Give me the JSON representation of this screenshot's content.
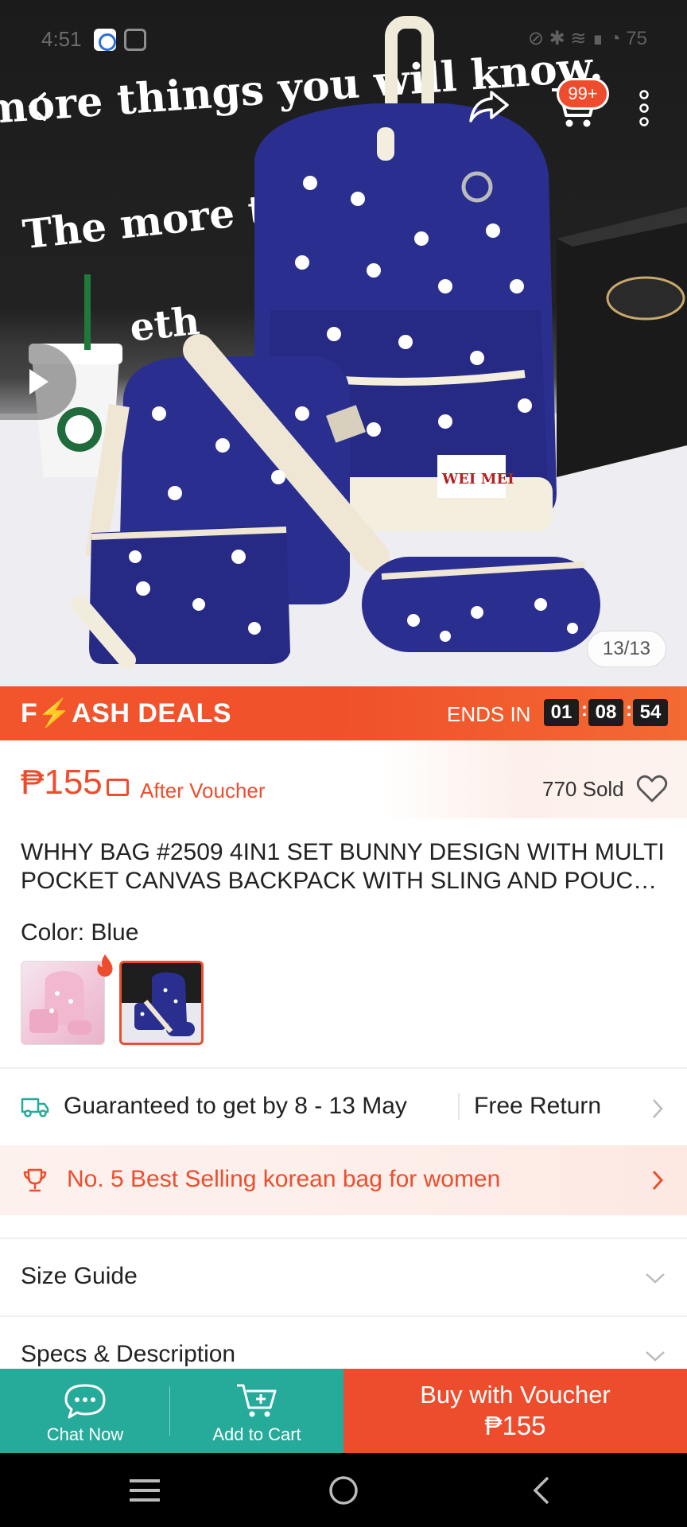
{
  "status_bar": {
    "time": "4:51",
    "right_text": "⊘ ✱ ≋ ∎ ◔ 75"
  },
  "hero": {
    "image_counter": "13/13",
    "cart_badge": "99+",
    "image_text": [
      "more things you will know.",
      "The more that",
      "eth"
    ],
    "tag_text": "WEI MEI"
  },
  "flash_deals": {
    "title": "F⚡ASH DEALS",
    "ends_label": "ENDS IN",
    "hours": "01",
    "minutes": "08",
    "seconds": "54"
  },
  "price": {
    "amount": "₱155",
    "after_voucher": "After Voucher",
    "sold": "770 Sold"
  },
  "product": {
    "title": "WHHY BAG #2509 4IN1 SET BUNNY DESIGN WITH MULTI POCKET CANVAS BACKPACK WITH SLING AND POUCH FOR WOMEN"
  },
  "color": {
    "label": "Color: Blue",
    "selected": "Blue"
  },
  "shipping": {
    "guarantee": "Guaranteed to get by 8 - 13 May",
    "free_return": "Free Return"
  },
  "best_selling": {
    "text": "No. 5 Best Selling korean bag for women"
  },
  "sections": {
    "size_guide": "Size Guide",
    "specs": "Specs & Description"
  },
  "bottom_bar": {
    "chat_label": "Chat Now",
    "add_cart_label": "Add to Cart",
    "buy_label": "Buy with Voucher",
    "buy_price": "₱155"
  },
  "colors": {
    "accent": "#ee4d2d",
    "teal": "#26aa99",
    "navy": "#2a2f8f"
  }
}
